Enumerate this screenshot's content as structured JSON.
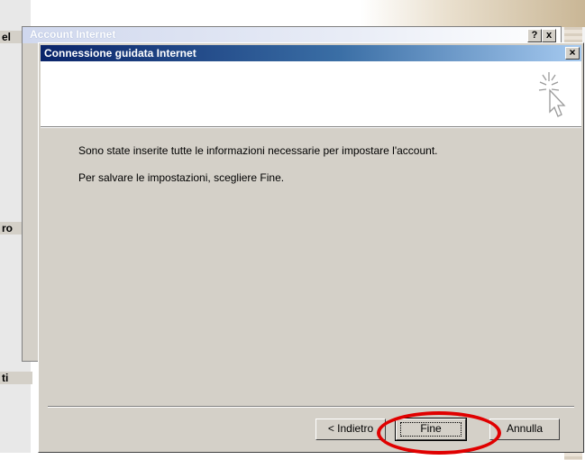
{
  "backdrop": {
    "side_labels": [
      "el",
      "ro",
      "ti"
    ]
  },
  "back_window": {
    "title": "Account Internet",
    "help_button": "?",
    "close_button": "x"
  },
  "wizard": {
    "title": "Connessione guidata Internet",
    "close_button": "×",
    "header_icon": "cursor-sparkle-icon",
    "message_line_1": "Sono state inserite tutte le informazioni necessarie per impostare l'account.",
    "message_line_2": "Per salvare le impostazioni, scegliere Fine.",
    "buttons": {
      "back": "< Indietro",
      "finish": "Fine",
      "cancel": "Annulla"
    }
  },
  "annotation": {
    "highlight_color": "#e00000",
    "highlighted_target": "Fine"
  }
}
